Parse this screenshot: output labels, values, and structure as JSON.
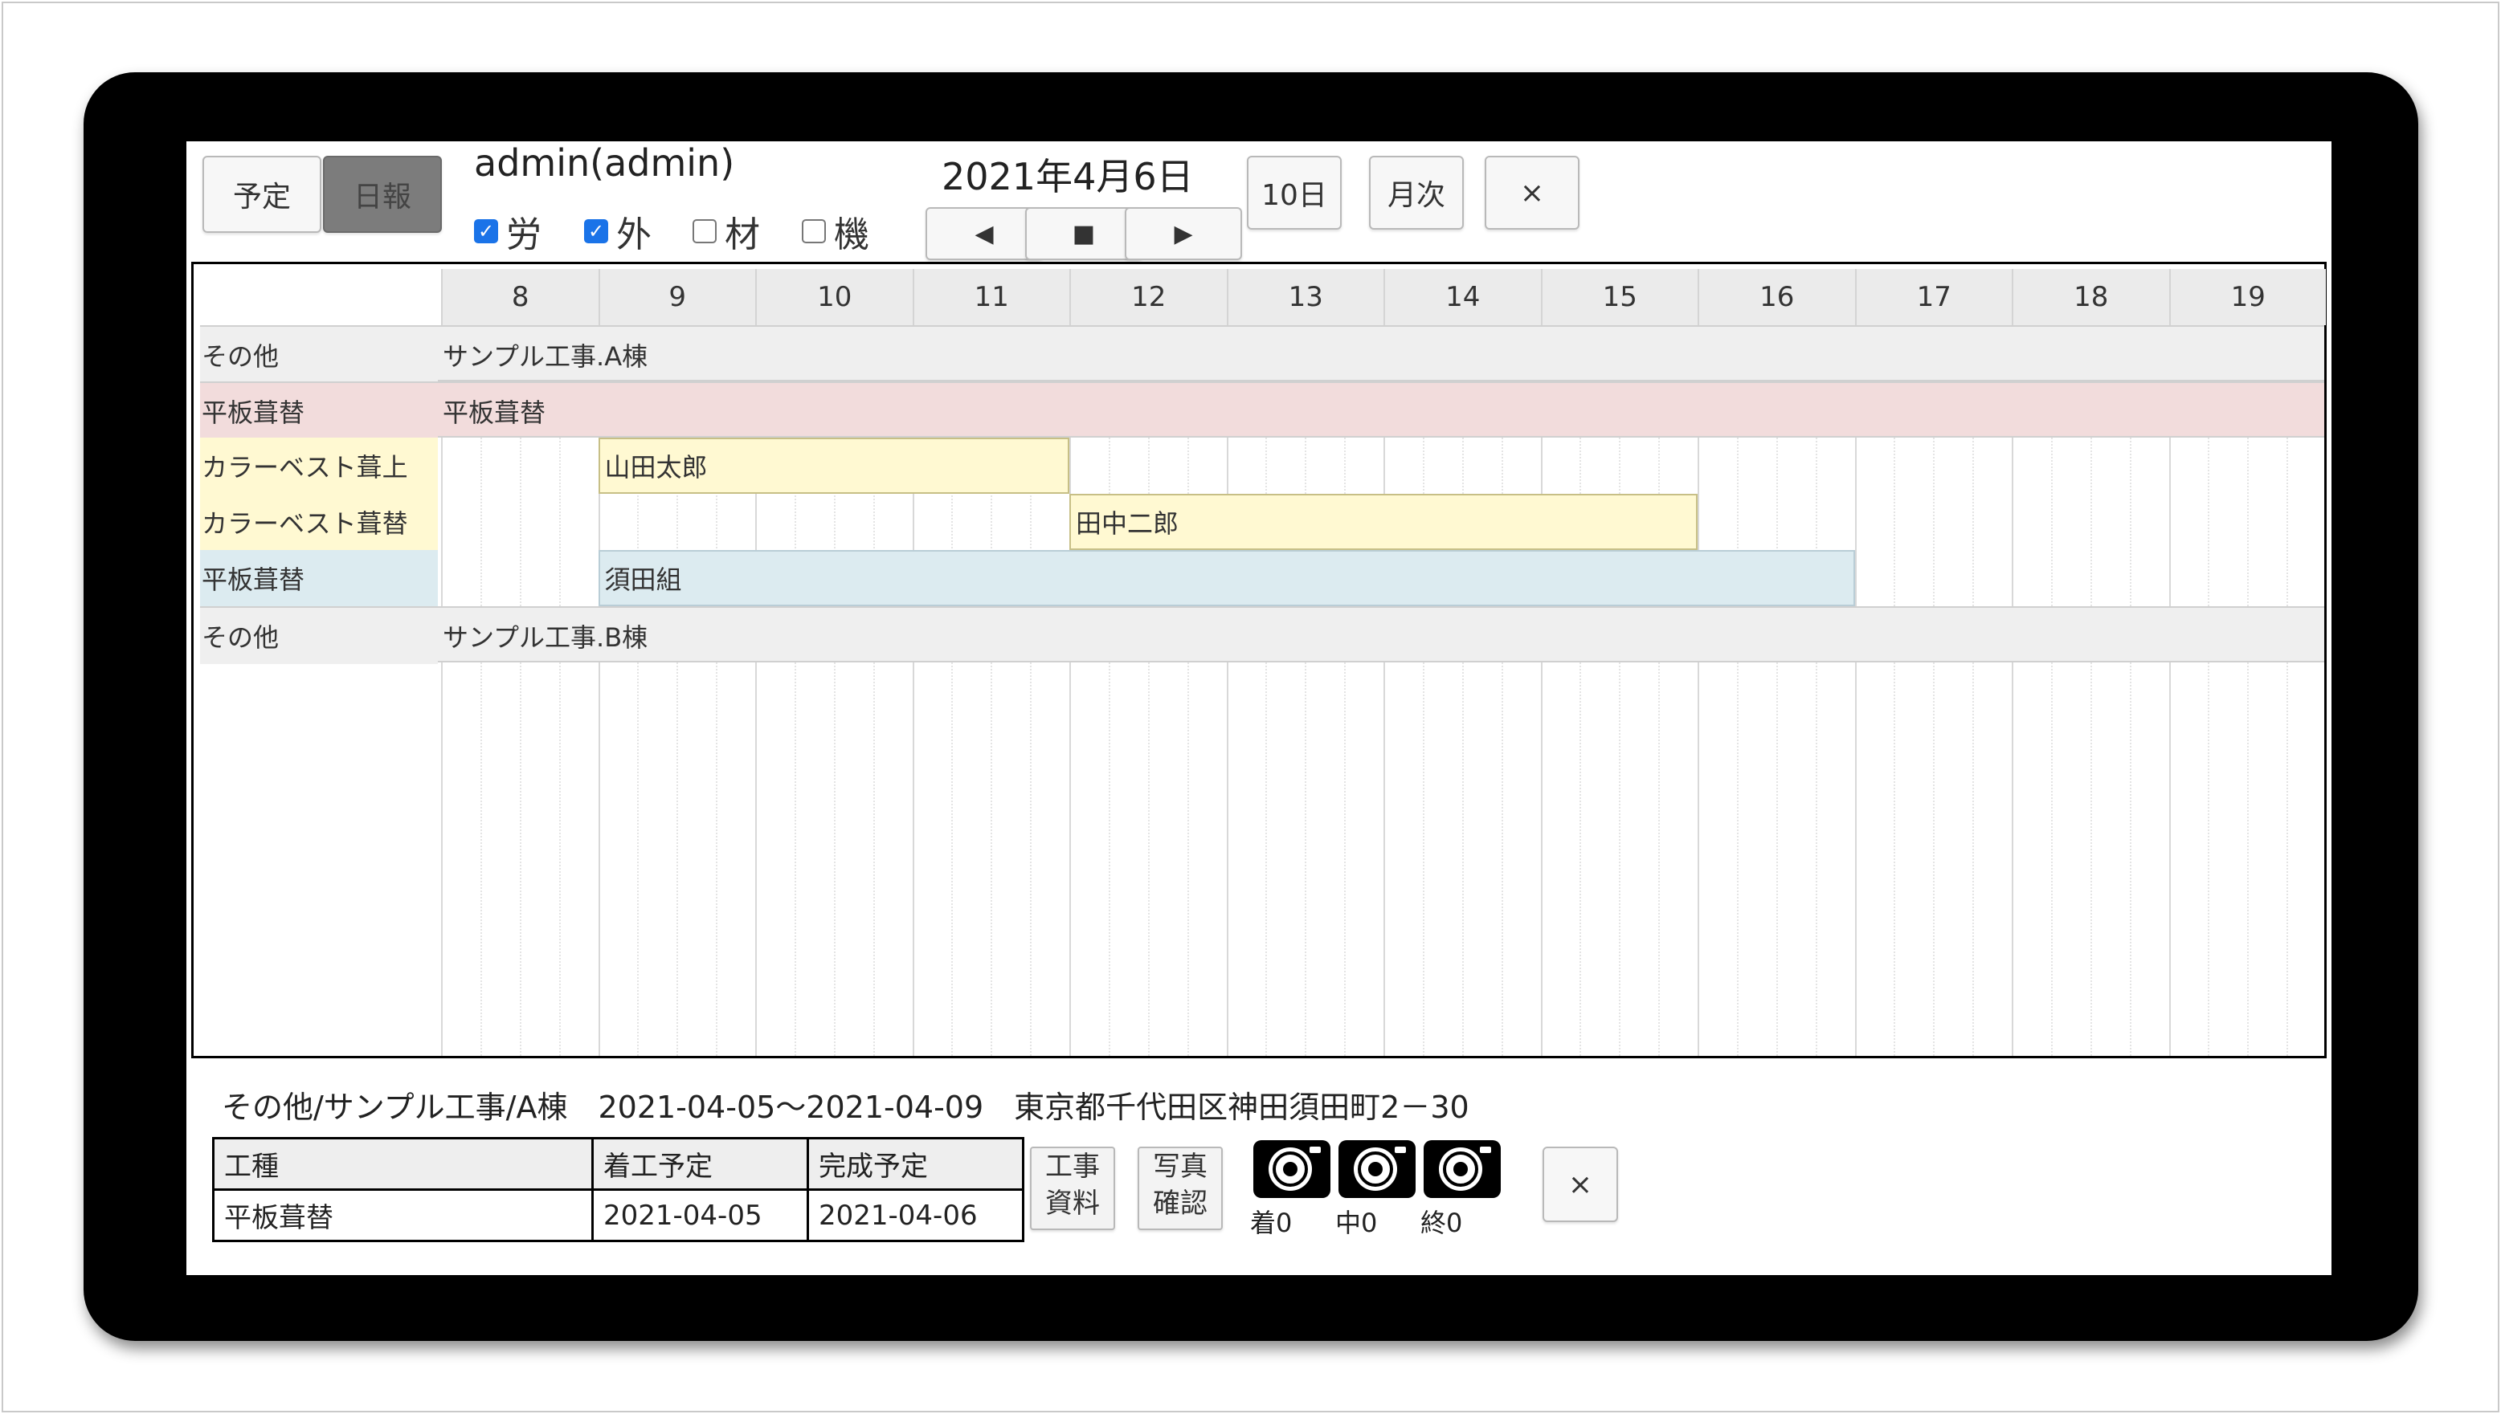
{
  "toolbar": {
    "plan_label": "予定",
    "daily_label": "日報",
    "user": "admin(admin)",
    "date": "2021年4月6日",
    "ten_day_label": "10日",
    "monthly_label": "月次",
    "close_label": "×",
    "prev_label": "◀",
    "today_label": "■",
    "next_label": "▶",
    "filters": [
      {
        "label": "労",
        "checked": true
      },
      {
        "label": "外",
        "checked": true
      },
      {
        "label": "材",
        "checked": false
      },
      {
        "label": "機",
        "checked": false
      }
    ]
  },
  "gantt": {
    "hours": [
      "8",
      "9",
      "10",
      "11",
      "12",
      "13",
      "14",
      "15",
      "16",
      "17",
      "18",
      "19"
    ],
    "rows": [
      {
        "label": "その他",
        "text": "サンプル工事.A棟",
        "color": "#efefef",
        "type": "group"
      },
      {
        "label": "平板葺替",
        "text": "平板葺替",
        "color": "#f2dcdc",
        "type": "group"
      },
      {
        "label": "カラーベスト葺上",
        "type": "task",
        "color": "#fff9d2",
        "bar": {
          "text": "山田太郎",
          "start": 9,
          "end": 12
        }
      },
      {
        "label": "カラーベスト葺替",
        "type": "task",
        "color": "#fff9d2",
        "bar": {
          "text": "田中二郎",
          "start": 12,
          "end": 16
        }
      },
      {
        "label": "平板葺替",
        "type": "task",
        "color": "#dcebf0",
        "bar": {
          "text": "須田組",
          "start": 9,
          "end": 17
        }
      },
      {
        "label": "その他",
        "text": "サンプル工事.B棟",
        "color": "#efefef",
        "type": "group"
      }
    ]
  },
  "detail": {
    "summary": "その他/サンプル工事/A棟　2021-04-05～2021-04-09　東京都千代田区神田須田町2－30",
    "headers": [
      "工種",
      "着工予定",
      "完成予定"
    ],
    "row": [
      "平板葺替",
      "2021-04-05",
      "2021-04-06"
    ],
    "docs_label": [
      "工事",
      "資料"
    ],
    "photo_label": [
      "写真",
      "確認"
    ],
    "photo_counts": [
      "着0",
      "中0",
      "終0"
    ],
    "close_label": "×"
  }
}
